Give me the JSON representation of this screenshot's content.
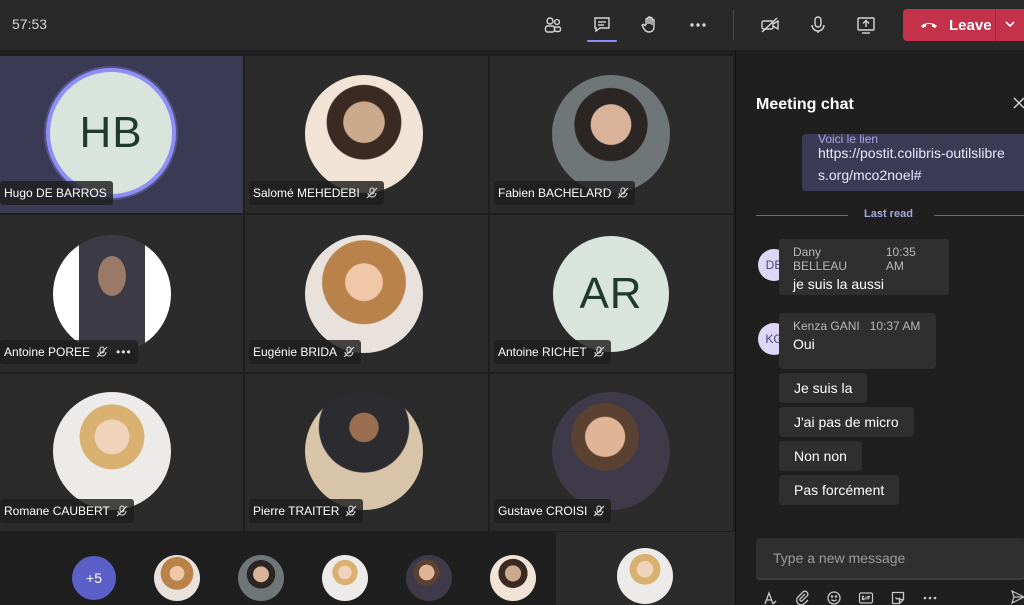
{
  "meeting": {
    "timer": "57:53",
    "leave_label": "Leave"
  },
  "toolbar": {
    "icons": [
      "participants-icon",
      "chat-icon",
      "raise-hand-icon",
      "more-actions-icon",
      "camera-off-icon",
      "microphone-icon",
      "share-screen-icon"
    ]
  },
  "participants": [
    {
      "name": "Hugo DE BARROS",
      "initials": "HB",
      "speaking": true
    },
    {
      "name": "Salomé MEHEDEBI"
    },
    {
      "name": "Fabien BACHELARD"
    },
    {
      "name": "Antoine POREE",
      "more": "•••"
    },
    {
      "name": "Eugénie BRIDA"
    },
    {
      "name": "Antoine RICHET",
      "initials": "AR"
    },
    {
      "name": "Romane CAUBERT"
    },
    {
      "name": "Pierre TRAITER"
    },
    {
      "name": "Gustave CROISI"
    }
  ],
  "overflow": {
    "more_count": "+5"
  },
  "chat": {
    "title": "Meeting chat",
    "link_text": "https://postit.colibris-outilslibres.org/mco2noel#",
    "link_cut_text": "Voici le lien",
    "last_read": "Last read",
    "messages": [
      {
        "initials": "DB",
        "author": "Dany BELLEAU",
        "time": "10:35 AM",
        "text": "je suis la aussi"
      },
      {
        "initials": "KG",
        "author": "Kenza GANI",
        "time": "10:37 AM",
        "text": "Oui",
        "followups": [
          "Je suis la",
          "J'ai pas de micro",
          "Non non",
          "Pas forcément"
        ]
      }
    ],
    "compose_placeholder": "Type a new message"
  },
  "colors": {
    "accent": "#6264a7",
    "leave": "#c4314b",
    "speaking_ring": "#8d8ff7"
  }
}
